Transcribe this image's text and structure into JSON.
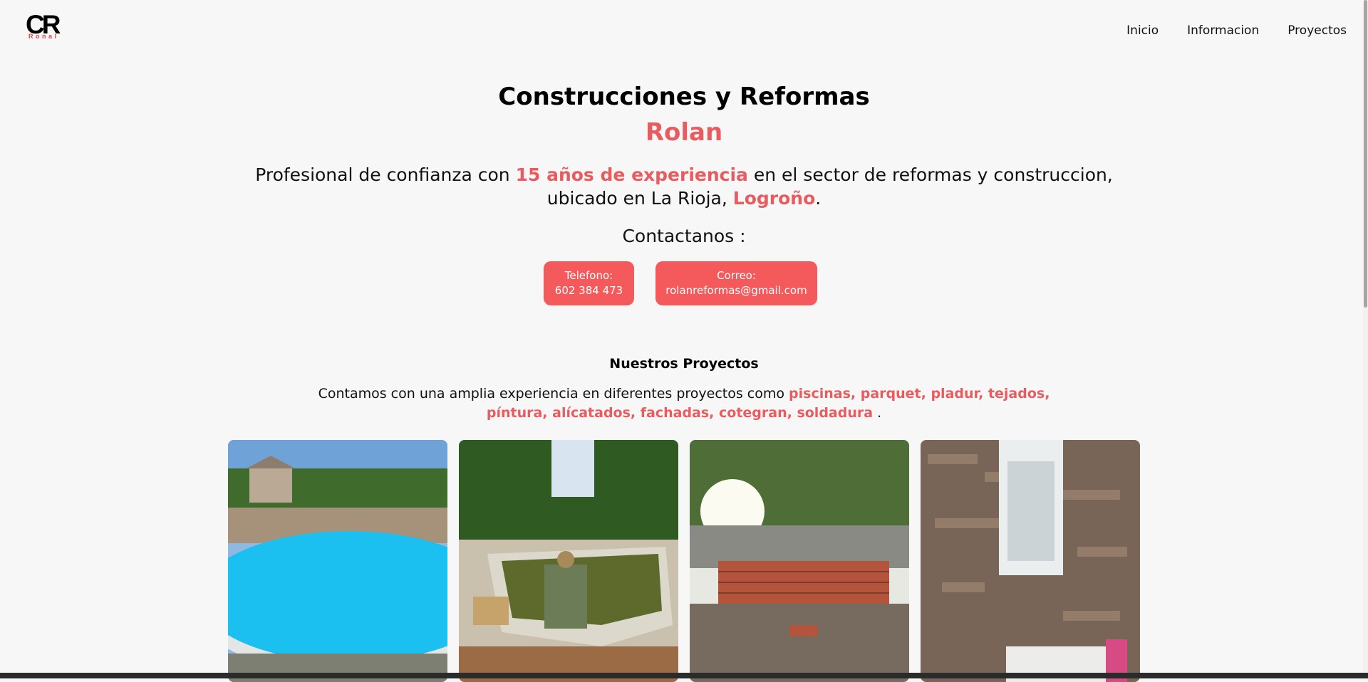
{
  "logo": {
    "letters": "CR",
    "subtext": "Ronal"
  },
  "nav": [
    "Inicio",
    "Informacion",
    "Proyectos"
  ],
  "hero": {
    "title": "Construcciones y Reformas",
    "subtitle": "Rolan",
    "desc_part1": "Profesional de confianza con ",
    "desc_accent1": "15 años de experiencia",
    "desc_part2": " en el sector de reformas y construccion,",
    "desc_part3": "ubicado en La Rioja, ",
    "desc_accent2": "Logroño",
    "desc_part4": ".",
    "contact_heading": "Contactanos :"
  },
  "contact": {
    "phone_label": "Telefono:",
    "phone_value": "602 384 473",
    "email_label": "Correo:",
    "email_value": "rolanreformas@gmail.com"
  },
  "projects": {
    "heading": "Nuestros Proyectos",
    "desc_part1": "Contamos con una amplia experiencia en diferentes proyectos como ",
    "accent_line1": "piscinas, parquet, pladur, tejados,",
    "accent_line2": "píntura, alícatados, fachadas, cotegran, soldadura",
    "desc_end": " ."
  },
  "gallery_images": [
    "pool-with-cover-photo",
    "pool-renovation-worker-photo",
    "brick-construction-photo",
    "bathroom-shower-photo"
  ],
  "colors": {
    "accent": "#e85c5f",
    "button": "#f45a5c",
    "background": "#f7f7f7"
  }
}
